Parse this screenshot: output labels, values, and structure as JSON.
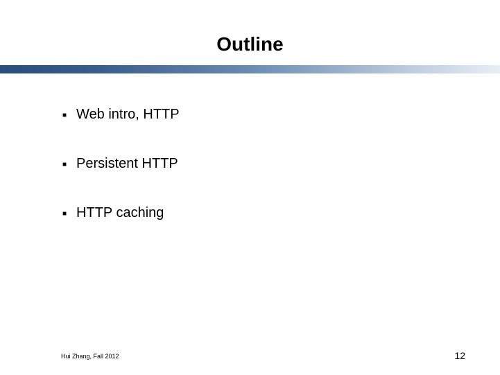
{
  "title": "Outline",
  "bullets": [
    {
      "text": "Web intro, HTTP"
    },
    {
      "text": "Persistent HTTP"
    },
    {
      "text": "HTTP caching"
    }
  ],
  "footer": {
    "author": "Hui Zhang, Fall 2012",
    "page_number": "12"
  }
}
